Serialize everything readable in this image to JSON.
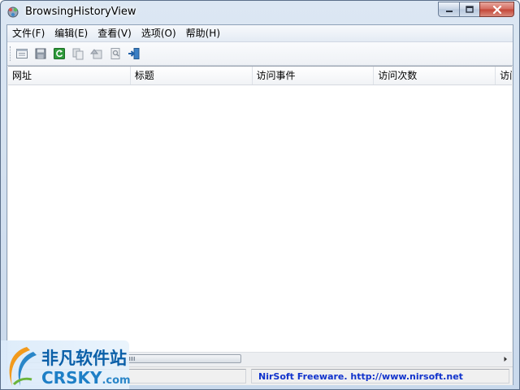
{
  "window": {
    "title": "BrowsingHistoryView"
  },
  "menu": [
    {
      "label": "文件(F)"
    },
    {
      "label": "编辑(E)"
    },
    {
      "label": "查看(V)"
    },
    {
      "label": "选项(O)"
    },
    {
      "label": "帮助(H)"
    }
  ],
  "toolbar": {
    "icons": [
      "properties-icon",
      "save-icon",
      "refresh-icon",
      "copy-icon",
      "html-report-icon",
      "find-icon",
      "exit-icon"
    ]
  },
  "list": {
    "columns": [
      {
        "label": "网址"
      },
      {
        "label": "标题"
      },
      {
        "label": "访问事件"
      },
      {
        "label": "访问次数"
      },
      {
        "label": "访问"
      }
    ]
  },
  "statusbar": {
    "link_text": "NirSoft Freeware.  http://www.nirsoft.net"
  },
  "watermark": {
    "cn": "非凡软件站",
    "en": "CRSKY",
    "com": ".com"
  },
  "colors": {
    "status_link": "#1133cc",
    "close_button": "#c34536",
    "title_gradient_top": "#dce7f3"
  }
}
